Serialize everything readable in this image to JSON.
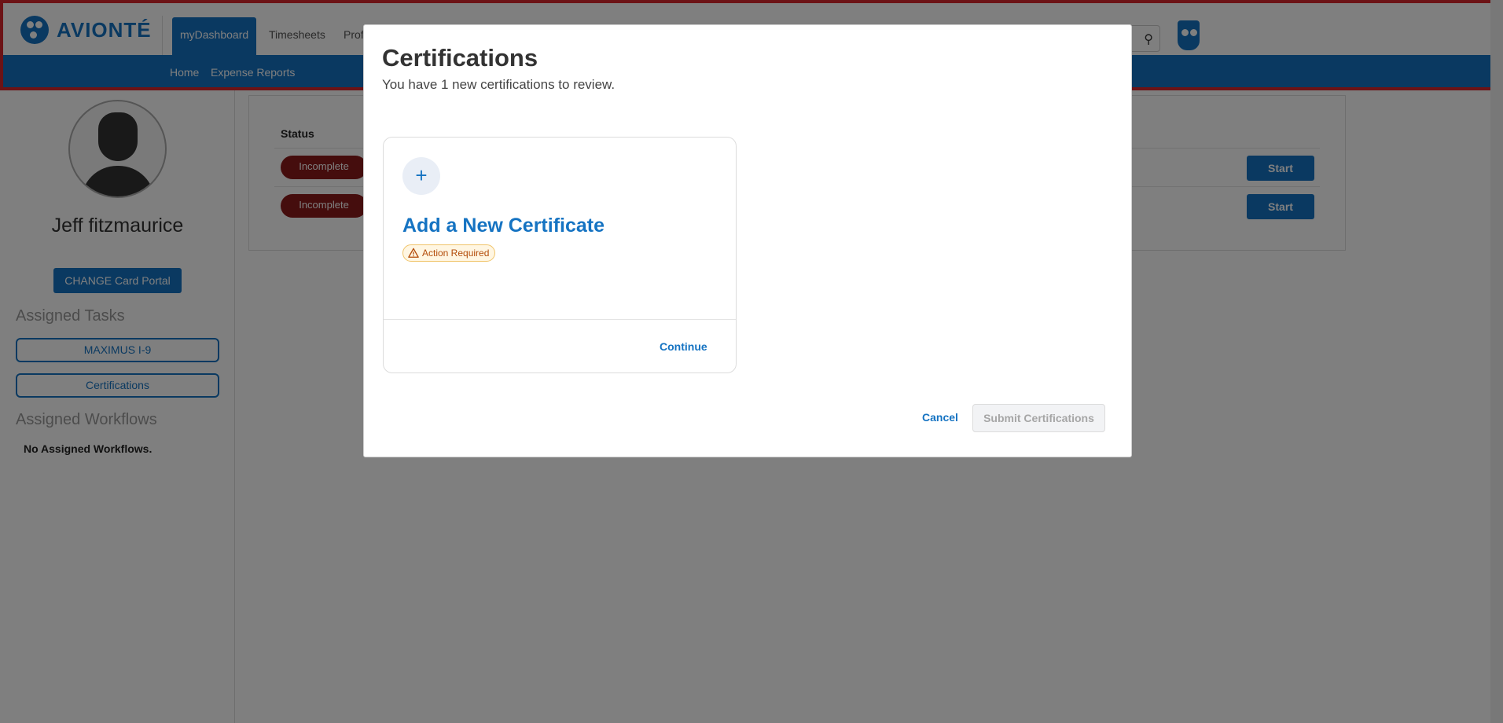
{
  "app": {
    "logo_text": "AVIONTÉ",
    "tabs": [
      {
        "label": "myDashboard",
        "active": true
      },
      {
        "label": "Timesheets",
        "active": false
      },
      {
        "label": "Profi",
        "active": false
      }
    ],
    "subnav": [
      "Home",
      "Expense Reports"
    ],
    "colors": {
      "brand": "#1573c2",
      "incomplete": "#8b1a1a",
      "frame": "#d9262c"
    }
  },
  "sidebar": {
    "user_name": "Jeff fitzmaurice",
    "portal_button": "CHANGE Card Portal",
    "assigned_tasks_title": "Assigned Tasks",
    "tasks": [
      "MAXIMUS I-9",
      "Certifications"
    ],
    "assigned_workflows_title": "Assigned Workflows",
    "no_workflows": "No Assigned Workflows."
  },
  "panel": {
    "status_header": "Status",
    "rows": [
      {
        "status": "Incomplete",
        "action": "Start"
      },
      {
        "status": "Incomplete",
        "action": "Start"
      }
    ]
  },
  "modal": {
    "title": "Certifications",
    "subtitle": "You have 1 new certifications to review.",
    "card": {
      "plus_icon": "plus-icon",
      "title": "Add a New Certificate",
      "badge": "Action Required",
      "continue_label": "Continue"
    },
    "cancel_label": "Cancel",
    "submit_label": "Submit Certifications"
  }
}
